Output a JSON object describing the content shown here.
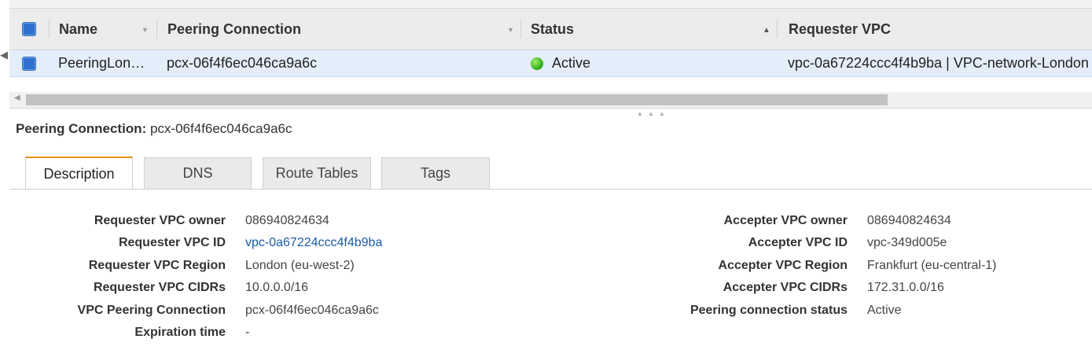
{
  "grid": {
    "columns": [
      "Name",
      "Peering Connection",
      "Status",
      "Requester VPC"
    ],
    "row": {
      "name": "PeeringLon…",
      "peering_connection": "pcx-06f4f6ec046ca9a6c",
      "status": "Active",
      "requester_vpc": "vpc-0a67224ccc4f4b9ba | VPC-network-London"
    }
  },
  "details": {
    "title_label": "Peering Connection:",
    "title_value": "pcx-06f4f6ec046ca9a6c",
    "tabs": [
      "Description",
      "DNS",
      "Route Tables",
      "Tags"
    ],
    "left": [
      {
        "label": "Requester VPC owner",
        "value": "086940824634"
      },
      {
        "label": "Requester VPC ID",
        "value": "vpc-0a67224ccc4f4b9ba"
      },
      {
        "label": "Requester VPC Region",
        "value": "London (eu-west-2)"
      },
      {
        "label": "Requester VPC CIDRs",
        "value": "10.0.0.0/16"
      },
      {
        "label": "VPC Peering Connection",
        "value": "pcx-06f4f6ec046ca9a6c"
      },
      {
        "label": "Expiration time",
        "value": "-"
      }
    ],
    "right": [
      {
        "label": "Accepter VPC owner",
        "value": "086940824634"
      },
      {
        "label": "Accepter VPC ID",
        "value": "vpc-349d005e"
      },
      {
        "label": "Accepter VPC Region",
        "value": "Frankfurt (eu-central-1)"
      },
      {
        "label": "Accepter VPC CIDRs",
        "value": "172.31.0.0/16"
      },
      {
        "label": "Peering connection status",
        "value": "Active"
      }
    ]
  },
  "colors": {
    "accent_tab": "#e8901f",
    "link": "#1a5aa8",
    "selected_row": "#e4eefb",
    "status_active": "#2aa813"
  }
}
